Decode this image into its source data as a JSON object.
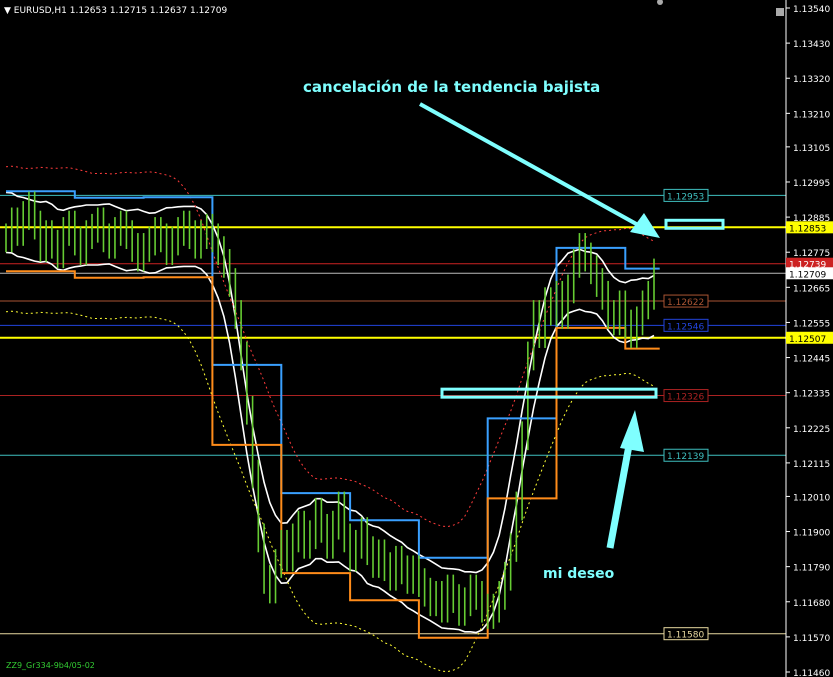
{
  "header": {
    "symbol_timeframe": "EURUSD,H1",
    "ohlc": "1.12653 1.12715 1.12637 1.12709"
  },
  "footer": {
    "indicator_label": "ZZ9_Gr334-9b4/05-02"
  },
  "annotations": {
    "trend_cancel": "cancelación de la tendencia bajista",
    "my_wish": "mi deseo"
  },
  "colors": {
    "background": "#000000",
    "candle": "#66cc33",
    "annotation": "#7fffff",
    "yellow_level": "#ffff00",
    "band": "#ffffff",
    "channel_blue": "#3aa0ff",
    "channel_orange": "#ff8c1a"
  },
  "chart_data": {
    "type": "line",
    "title": "EURUSD,H1",
    "y_range": [
      1.1146,
      1.1354
    ],
    "y_ticks": [
      "1.13540",
      "1.13430",
      "1.13320",
      "1.13210",
      "1.13105",
      "1.12995",
      "1.12885",
      "1.12775",
      "1.12665",
      "1.12555",
      "1.12445",
      "1.12335",
      "1.12225",
      "1.12115",
      "1.12010",
      "1.11900",
      "1.11790",
      "1.11680",
      "1.11570",
      "1.11460"
    ],
    "horizontal_levels": [
      {
        "label": "1.12953",
        "value": 1.12953,
        "color": "#3fbfbf",
        "label_style": "boxed"
      },
      {
        "label": "1.12853",
        "value": 1.12853,
        "color": "#ffff00",
        "label_style": "filled"
      },
      {
        "label": "1.12739",
        "value": 1.12739,
        "color": "#cc2222",
        "label_style": "filled-red"
      },
      {
        "label": "1.12709",
        "value": 1.12709,
        "color": "#bbbbbb",
        "label_style": "filled-white"
      },
      {
        "label": "1.12622",
        "value": 1.12622,
        "color": "#aa5533",
        "label_style": "boxed"
      },
      {
        "label": "1.12546",
        "value": 1.12546,
        "color": "#2244dd",
        "label_style": "boxed"
      },
      {
        "label": "1.12507",
        "value": 1.12507,
        "color": "#ffff00",
        "label_style": "filled"
      },
      {
        "label": "1.12326",
        "value": 1.12326,
        "color": "#aa2222",
        "label_style": "boxed"
      },
      {
        "label": "1.12139",
        "value": 1.12139,
        "color": "#3fbfbf",
        "label_style": "boxed"
      },
      {
        "label": "1.11580",
        "value": 1.1158,
        "color": "#e8d9a0",
        "label_style": "boxed"
      }
    ],
    "bars": [
      1.1282,
      1.1287,
      1.1284,
      1.1289,
      1.1292,
      1.1286,
      1.1279,
      1.1283,
      1.128,
      1.1277,
      1.1284,
      1.1286,
      1.1281,
      1.1278,
      1.1283,
      1.1285,
      1.1287,
      1.1282,
      1.128,
      1.1284,
      1.1286,
      1.1283,
      1.1279,
      1.1276,
      1.1279,
      1.1281,
      1.1284,
      1.1282,
      1.1278,
      1.1281,
      1.1284,
      1.1286,
      1.1283,
      1.128,
      1.1283,
      1.1285,
      1.1282,
      1.1278,
      1.1274,
      1.1268,
      1.1258,
      1.1245,
      1.1228,
      1.1208,
      1.1188,
      1.1175,
      1.1172,
      1.118,
      1.1186,
      1.1182,
      1.1188,
      1.1192,
      1.1186,
      1.1189,
      1.1196,
      1.1191,
      1.1186,
      1.1192,
      1.1198,
      1.1188,
      1.1182,
      1.1186,
      1.119,
      1.1184,
      1.118,
      1.1183,
      1.1179,
      1.1176,
      1.1181,
      1.1178,
      1.1175,
      1.1178,
      1.1174,
      1.1171,
      1.1168,
      1.117,
      1.1166,
      1.1172,
      1.1169,
      1.1165,
      1.1168,
      1.1172,
      1.117,
      1.1166,
      1.1164,
      1.1166,
      1.117,
      1.1176,
      1.1185,
      1.1198,
      1.122,
      1.1245,
      1.1258,
      1.1252,
      1.1262,
      1.1259,
      1.1264,
      1.1258,
      1.1266,
      1.1274,
      1.1279,
      1.1276,
      1.1272,
      1.1268,
      1.1264,
      1.1258,
      1.1256,
      1.1261,
      1.1255,
      1.1252,
      1.1256,
      1.1261,
      1.1264,
      1.1271
    ],
    "boxes": [
      {
        "role": "trend-cancel-zone",
        "level_from": 1.12853,
        "level_to": 1.12875
      },
      {
        "role": "target-zone",
        "level_from": 1.12326,
        "level_to": 1.12346
      }
    ]
  }
}
